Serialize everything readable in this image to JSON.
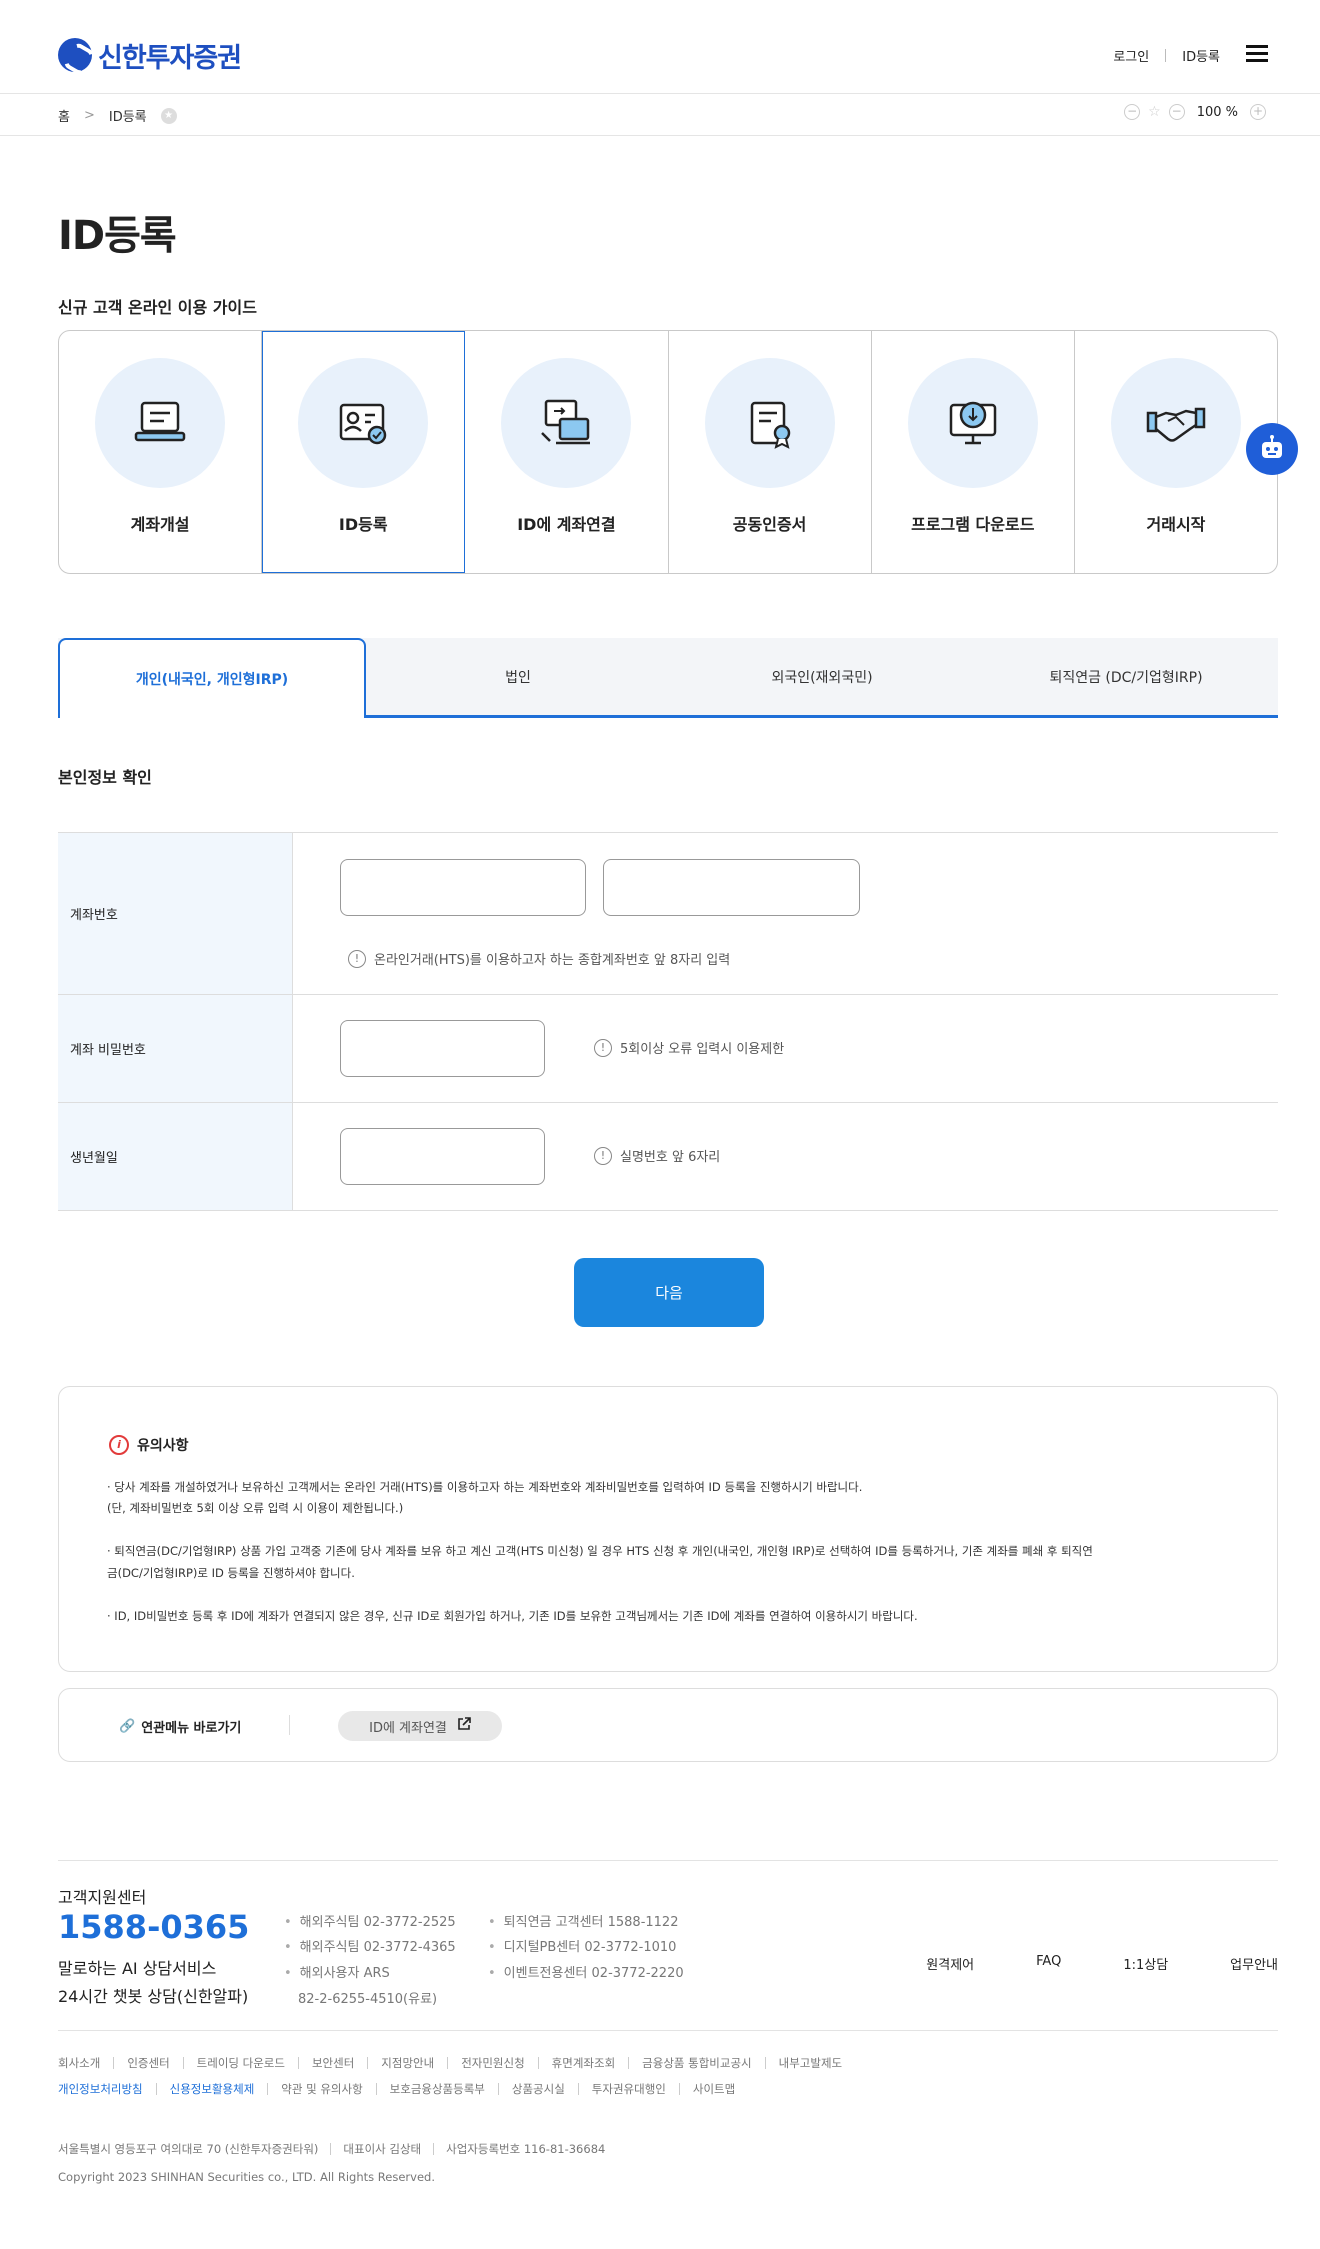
{
  "brand": {
    "name": "신한투자증권",
    "color": "#1e4fc0",
    "accent": "#1e6fd8"
  },
  "header": {
    "login": "로그인",
    "id_register": "ID등록",
    "menu_icon": "hamburger-icon"
  },
  "breadcrumb": {
    "home": "홈",
    "sep": ">",
    "current": "ID등록",
    "zoom": "100 %",
    "zoom_out": "−",
    "zoom_in": "+"
  },
  "page_title": "ID등록",
  "guide": {
    "title": "신규 고객 온라인 이용 가이드",
    "items": [
      {
        "label": "계좌개설",
        "icon": "laptop-icon"
      },
      {
        "label": "ID등록",
        "icon": "id-card-icon"
      },
      {
        "label": "ID에 계좌연결",
        "icon": "link-devices-icon"
      },
      {
        "label": "공동인증서",
        "icon": "certificate-icon"
      },
      {
        "label": "프로그램 다운로드",
        "icon": "download-monitor-icon"
      },
      {
        "label": "거래시작",
        "icon": "handshake-icon"
      }
    ]
  },
  "tabs": [
    {
      "label": "개인(내국인, 개인형IRP)",
      "active": true
    },
    {
      "label": "법인"
    },
    {
      "label": "외국인(재외국민)"
    },
    {
      "label": "퇴직연금 (DC/기업형IRP)"
    }
  ],
  "form": {
    "title": "본인정보 확인",
    "account_label": "계좌번호",
    "account_hint": "온라인거래(HTS)를 이용하고자 하는 종합계좌번호 앞 8자리 입력",
    "password_label": "계좌 비밀번호",
    "password_hint": "5회이상 오류 입력시 이용제한",
    "birth_label": "생년월일",
    "birth_hint": "실명번호 앞 6자리",
    "hint_mark": "!"
  },
  "next_button": "다음",
  "notice": {
    "icon_mark": "i",
    "title": "유의사항",
    "lines": [
      "· 당사 계좌를 개설하였거나 보유하신 고객께서는 온라인 거래(HTS)를 이용하고자 하는 계좌번호와 계좌비밀번호를 입력하여 ID 등록을 진행하시기 바랍니다.",
      "(단, 계좌비밀번호 5회 이상 오류 입력 시 이용이 제한됩니다.)",
      "· 퇴직연금(DC/기업형IRP) 상품 가입 고객중 기존에 당사 계좌를 보유 하고 계신 고객(HTS 미신청) 일 경우 HTS 신청 후 개인(내국인, 개인형 IRP)로 선택하여 ID를 등록하거나, 기존 계좌를 폐쇄 후 퇴직연",
      "금(DC/기업형IRP)로 ID 등록을 진행하셔야 합니다.",
      "· ID, ID비밀번호 등록 후 ID에 계좌가 연결되지 않은 경우, 신규 ID로 회원가입 하거나, 기존 ID를 보유한 고객님께서는 기존 ID에 계좌를 연결하여 이용하시기 바랍니다."
    ]
  },
  "related": {
    "label": "연관메뉴 바로가기",
    "button": "ID에 계좌연결"
  },
  "footer": {
    "cs_title": "고객지원센터",
    "cs_phone": "1588-0365",
    "ai_service": "말로하는 AI 상담서비스",
    "chatbot": "24시간 챗봇 상담(신한알파)",
    "phones_col1": [
      "해외주식팀 02-3772-2525",
      "해외주식팀 02-3772-4365",
      "해외사용자 ARS",
      "82-2-6255-4510(유료)"
    ],
    "phones_col2": [
      "퇴직연금 고객센터 1588-1122",
      "디지털PB센터 02-3772-1010",
      "이벤트전용센터 02-3772-2220"
    ],
    "links": [
      "원격제어",
      "FAQ",
      "1:1상담",
      "업무안내"
    ],
    "nav_row1": [
      "회사소개",
      "인증센터",
      "트레이딩 다운로드",
      "보안센터",
      "지점망안내",
      "전자민원신청",
      "휴면계좌조회",
      "금융상품 통합비교공시",
      "내부고발제도"
    ],
    "nav_row2": [
      "개인정보처리방침",
      "신용정보활용체제",
      "약관 및 유의사항",
      "보호금융상품등록부",
      "상품공시실",
      "투자권유대행인",
      "사이트맵"
    ],
    "address": [
      "서울특별시 영등포구 여의대로 70 (신한투자증권타워)",
      "대표이사 김상태",
      "사업자등록번호 116-81-36684"
    ],
    "copyright": "Copyright 2023 SHINHAN Securities co., LTD. All Rights Reserved."
  }
}
